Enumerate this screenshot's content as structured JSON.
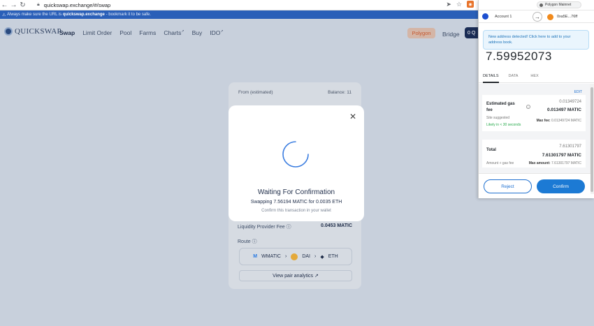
{
  "browser": {
    "url": "quickswap.exchange/#/swap",
    "banner_prefix": "Always make sure the URL is",
    "banner_domain": "quickswap.exchange",
    "banner_suffix": "- bookmark it to be safe."
  },
  "app": {
    "logo": "QUICKSWAP",
    "nav": [
      "Swap",
      "Limit Order",
      "Pool",
      "Farms",
      "Charts",
      "Buy",
      "IDO"
    ],
    "network": "Polygon",
    "bridge": "Bridge",
    "account_short": "0 Q"
  },
  "swap_card": {
    "from_label": "From (estimated)",
    "balance": "Balance: 11",
    "lpf_label": "Liquidity Provider Fee",
    "lpf_value": "0.0453 MATIC",
    "route_label": "Route",
    "route": [
      "WMATIC",
      "DAI",
      "ETH"
    ],
    "view_pair": "View pair analytics ↗"
  },
  "modal": {
    "title": "Waiting For Confirmation",
    "subtitle": "Swapping 7.56194 MATIC for 0.0035 ETH",
    "note": "Confirm this transaction in your wallet"
  },
  "metamask": {
    "network": "Polygon Mainnet",
    "account_from": "Account 1",
    "account_to": "0xa5E...76ff",
    "notice": "New address detected! Click here to add to your address book.",
    "amount": "7.59952073",
    "tabs": [
      "DETAILS",
      "DATA",
      "HEX"
    ],
    "edit": "EDIT",
    "gas_label": "Estimated gas fee",
    "gas_value": "0.01349724",
    "gas_value_bold": "0.013497 MATIC",
    "site_suggested": "Site suggested",
    "likely": "Likely in < 30 seconds",
    "max_fee_label": "Max fee:",
    "max_fee_value": "0.01349724 MATIC",
    "total_label": "Total",
    "total_value": "7.61301797",
    "total_value_bold": "7.61301797 MATIC",
    "amount_gas": "Amount + gas fee",
    "max_amount_label": "Max amount:",
    "max_amount_value": "7.61301797 MATIC",
    "reject": "Reject",
    "confirm": "Confirm"
  }
}
